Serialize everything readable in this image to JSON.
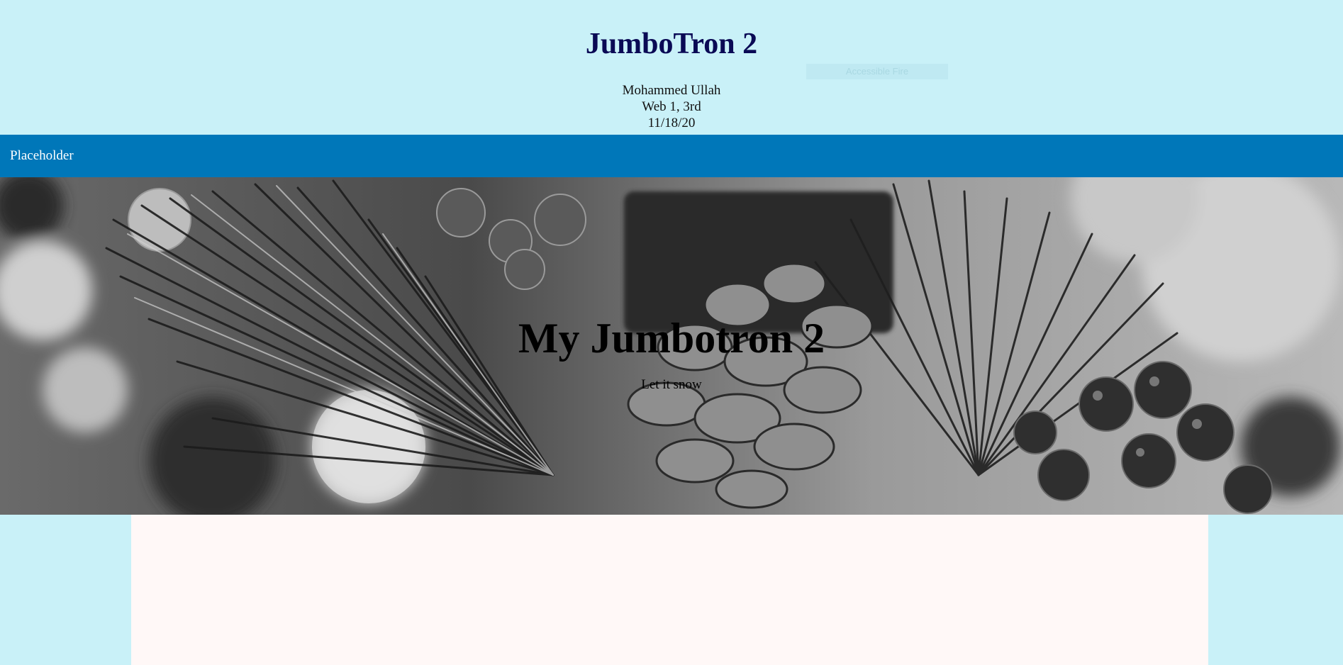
{
  "header": {
    "title": "JumboTron 2",
    "author": "Mohammed Ullah",
    "class": "Web 1, 3rd",
    "date": "11/18/20",
    "validator_label": "Accessible Fire"
  },
  "navbar": {
    "brand": "Placeholder",
    "color": "#0077b9"
  },
  "hero": {
    "title": "My Jumbotron 2",
    "subtitle": "Let it snow"
  },
  "colors": {
    "page_bg": "#c9f1f8",
    "title": "#0a0a55",
    "content_bg": "#fff8f7"
  }
}
